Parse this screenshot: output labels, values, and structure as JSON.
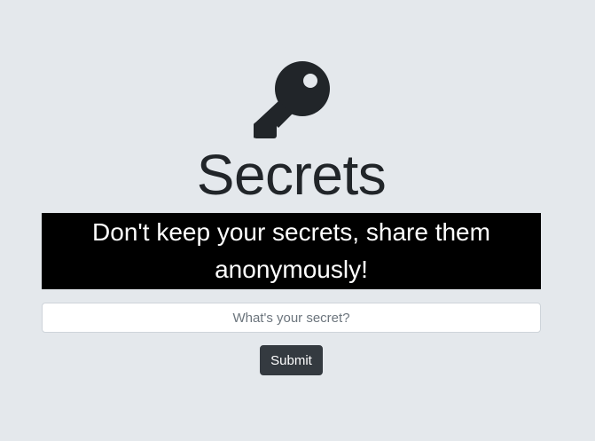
{
  "header": {
    "icon": "key-icon",
    "title": "Secrets"
  },
  "banner": {
    "text": "Don't keep your secrets, share them anonymously!"
  },
  "form": {
    "secret_placeholder": "What's your secret?",
    "secret_value": "",
    "submit_label": "Submit"
  },
  "colors": {
    "background": "#e4e8ec",
    "banner_background": "#000000",
    "banner_text": "#ffffff",
    "button_background": "#343a40",
    "text": "#212529"
  }
}
